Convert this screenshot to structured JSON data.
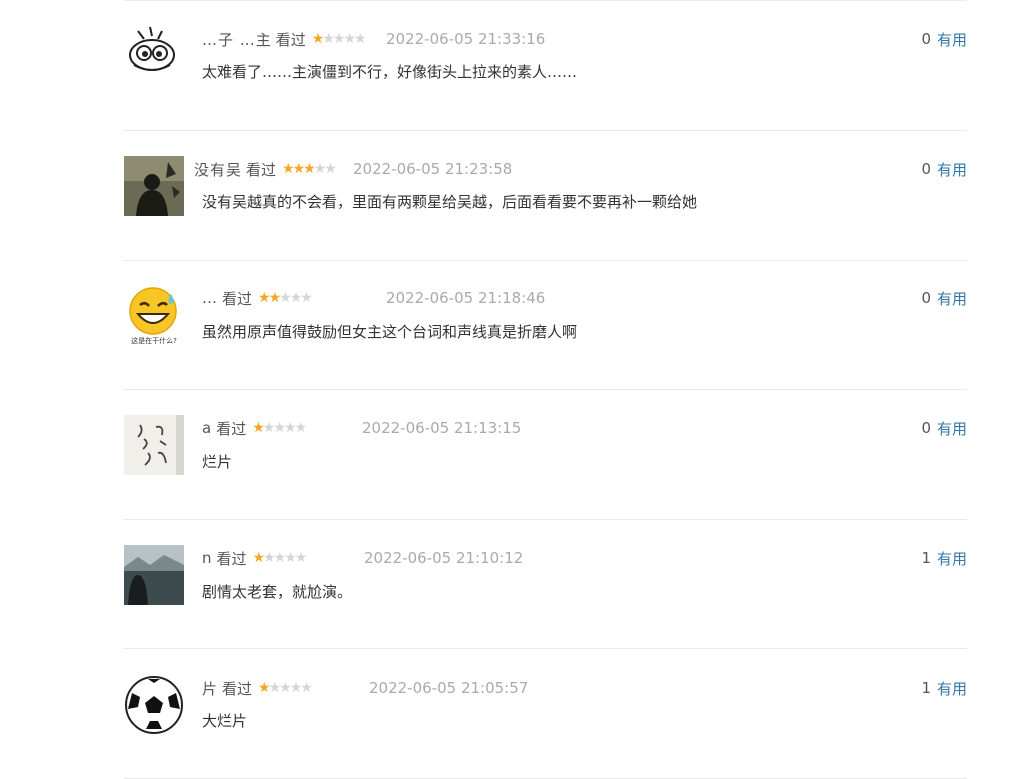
{
  "status_label": "看过",
  "useful_label": "有用",
  "colors": {
    "star_on": "#f5a623",
    "star_off": "#d5d5d5",
    "link": "#3377aa",
    "time": "#aaaaaa"
  },
  "comments": [
    {
      "user": "…子 …主",
      "rating": 1,
      "time": "2022-06-05 21:33:16",
      "votes": "0",
      "text": "太难看了……主演僵到不行，好像街头上拉来的素人……",
      "avatar": "cartoon-face"
    },
    {
      "user": "没有吴",
      "rating": 3,
      "time": "2022-06-05 21:23:58",
      "votes": "0",
      "text": "没有吴越真的不会看，里面有两颗星给吴越，后面看看要不要再补一颗给她",
      "avatar": "silhouette-photo"
    },
    {
      "user": "…",
      "rating": 2,
      "time": "2022-06-05 21:18:46",
      "votes": "0",
      "text": "虽然用原声值得鼓励但女主这个台词和声线真是折磨人啊",
      "avatar": "sweat-smile-emoji",
      "avatar_caption": "这是在干什么?"
    },
    {
      "user": "a",
      "rating": 1,
      "time": "2022-06-05 21:13:15",
      "votes": "0",
      "text": "烂片",
      "avatar": "calligraphy"
    },
    {
      "user": "n",
      "rating": 1,
      "time": "2022-06-05 21:10:12",
      "votes": "1",
      "text": "剧情太老套，就尬演。",
      "avatar": "dark-photo"
    },
    {
      "user": "片",
      "rating": 1,
      "time": "2022-06-05 21:05:57",
      "votes": "1",
      "text": "大烂片",
      "avatar": "soccer-ball"
    }
  ]
}
